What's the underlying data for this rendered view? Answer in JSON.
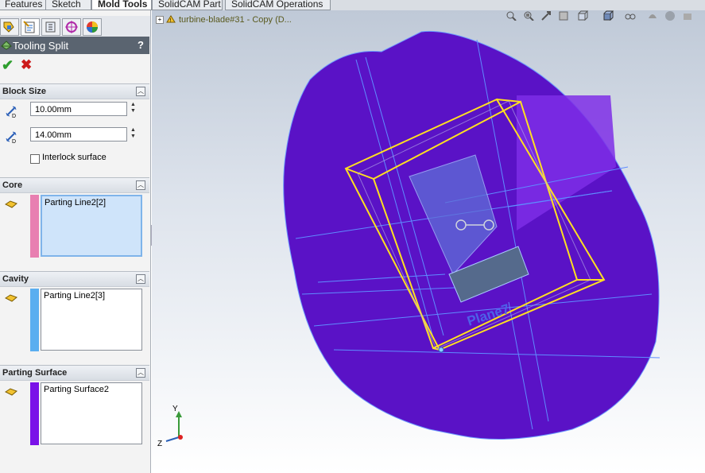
{
  "command_manager": {
    "tabs": [
      "Features",
      "Sketch",
      "Mold Tools",
      "SolidCAM Part",
      "SolidCAM Operations"
    ],
    "active_tab": "Mold Tools"
  },
  "property_manager": {
    "title": "Tooling Split",
    "help_label": "?",
    "ok_glyph": "✔",
    "cancel_glyph": "✖",
    "block_size": {
      "title": "Block Size",
      "depth1": "10.00mm",
      "depth2": "14.00mm",
      "interlock_label": "Interlock surface",
      "interlock_checked": false
    },
    "core": {
      "title": "Core",
      "item": "Parting Line2[2]",
      "color": "#e87fb1"
    },
    "cavity": {
      "title": "Cavity",
      "item": "Parting Line2[3]",
      "color": "#5aaef0"
    },
    "parting_surface": {
      "title": "Parting Surface",
      "item": "Parting Surface2",
      "color": "#7a12e8"
    }
  },
  "viewport": {
    "tree_label": "turbine-blade#31 - Copy  (D...",
    "plane_label": "Plane7",
    "triad": {
      "x": "Y",
      "z": "Z"
    },
    "colors": {
      "parting": "#5a12c6",
      "block": "#ffe020",
      "edge": "#6c9bff"
    },
    "hud_icons": [
      "zoom-to-fit-icon",
      "zoom-area-icon",
      "previous-view-icon",
      "section-view-icon",
      "view-orientation-icon",
      "display-style-icon",
      "hide-show-icon",
      "edit-appearance-icon",
      "apply-scene-icon",
      "view-settings-icon"
    ]
  }
}
